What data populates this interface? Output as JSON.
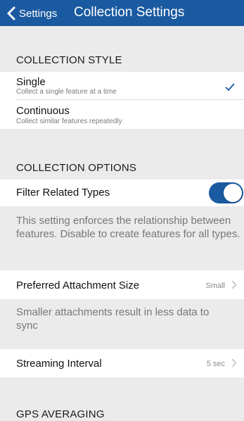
{
  "nav": {
    "back_label": "Settings",
    "title": "Collection Settings"
  },
  "collection_style": {
    "header": "COLLECTION STYLE",
    "options": [
      {
        "title": "Single",
        "subtitle": "Collect a single feature at a time",
        "selected": true
      },
      {
        "title": "Continuous",
        "subtitle": "Collect similar features repeatedly",
        "selected": false
      }
    ]
  },
  "collection_options": {
    "header": "COLLECTION OPTIONS",
    "filter_related_types": {
      "label": "Filter Related Types",
      "enabled": true,
      "description": "This setting enforces the relationship between features. Disable to create features for all types."
    },
    "preferred_attachment_size": {
      "label": "Preferred Attachment Size",
      "value": "Small",
      "description": "Smaller attachments result in less data to sync"
    },
    "streaming_interval": {
      "label": "Streaming Interval",
      "value": "5 sec"
    }
  },
  "gps_averaging": {
    "header": "GPS AVERAGING"
  },
  "colors": {
    "accent": "#1a5aa0",
    "background": "#ebebeb",
    "row": "#ffffff"
  },
  "icons": {
    "back": "chevron-left-icon",
    "check": "checkmark-icon",
    "disclosure": "chevron-right-icon"
  }
}
